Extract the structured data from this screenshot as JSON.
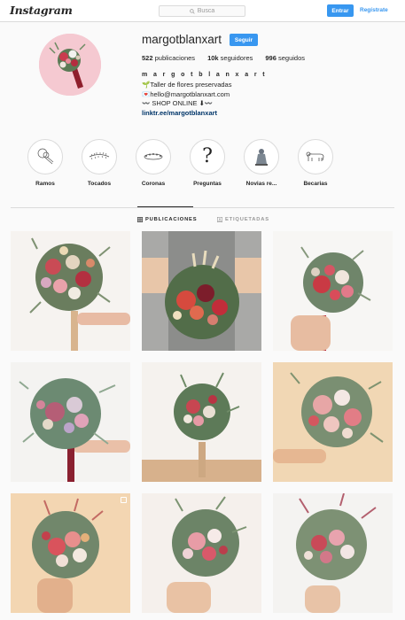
{
  "nav": {
    "logo": "Instagram",
    "search_placeholder": "Busca",
    "login_label": "Entrar",
    "signup_label": "Regístrate"
  },
  "profile": {
    "username": "margotblanxart",
    "follow_label": "Seguir",
    "stats": {
      "posts_count": "522",
      "posts_label": "publicaciones",
      "followers_count": "10k",
      "followers_label": "seguidores",
      "following_count": "996",
      "following_label": "seguidos"
    },
    "bio": {
      "name": "m a r g o t b l a n x a r t",
      "line1": "🌱Taller de flores preservadas",
      "line2": "💌hello@margotblanxart.com",
      "line3": "〰️ SHOP ONLINE ⬇︎〰️",
      "link": "linktr.ee/margotblanxart"
    }
  },
  "highlights": [
    {
      "label": "Ramos",
      "icon": "bouquet-sketch-icon"
    },
    {
      "label": "Tocados",
      "icon": "crown-wreath-sketch-icon"
    },
    {
      "label": "Coronas",
      "icon": "flower-crown-sketch-icon"
    },
    {
      "label": "Preguntas",
      "icon": "question-mark-icon"
    },
    {
      "label": "Novias re...",
      "icon": "bride-sketch-icon"
    },
    {
      "label": "Becarias",
      "icon": "dog-sketch-icon"
    }
  ],
  "tabs": {
    "posts": "PUBLICACIONES",
    "tagged": "ETIQUETADAS"
  },
  "colors": {
    "accent": "#3897f0",
    "border": "#dbdbdb",
    "background": "#fafafa",
    "text": "#262626",
    "link": "#003569"
  },
  "posts": [
    {
      "kind": "bouquet-photo"
    },
    {
      "kind": "bouquet-photo"
    },
    {
      "kind": "bouquet-photo"
    },
    {
      "kind": "bouquet-photo"
    },
    {
      "kind": "bouquet-photo"
    },
    {
      "kind": "bouquet-photo"
    },
    {
      "kind": "bouquet-photo"
    },
    {
      "kind": "bouquet-photo"
    },
    {
      "kind": "bouquet-photo"
    }
  ]
}
